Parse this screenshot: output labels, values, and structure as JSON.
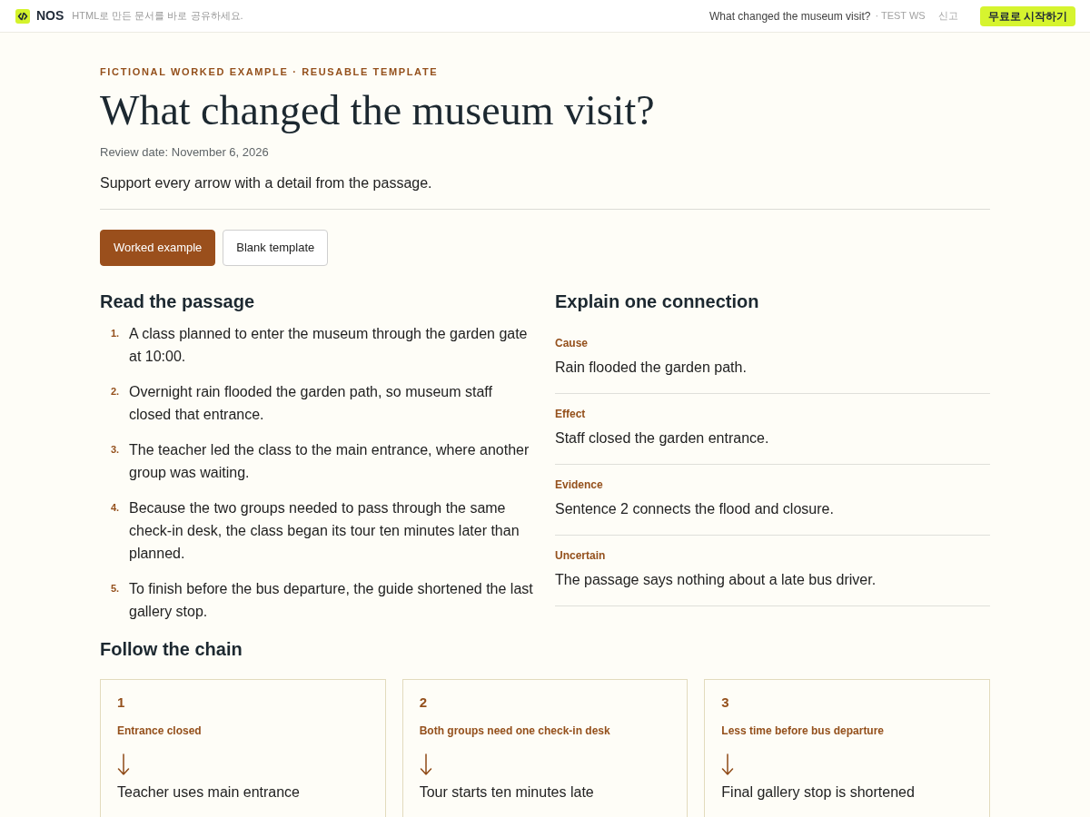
{
  "topbar": {
    "brand": "NOS",
    "tagline": "HTML로 만든 문서를 바로 공유하세요.",
    "doc_title": "What changed the museum visit?",
    "workspace": "· TEST WS",
    "report_link": "신고",
    "cta_button": "무료로 시작하기"
  },
  "header": {
    "eyebrow": "FICTIONAL WORKED EXAMPLE · REUSABLE TEMPLATE",
    "title": "What changed the museum visit?",
    "review_date": "Review date: November 6, 2026",
    "instruction": "Support every arrow with a detail from the passage."
  },
  "tabs": [
    {
      "label": "Worked example",
      "selected": true
    },
    {
      "label": "Blank template",
      "selected": false
    }
  ],
  "passage": {
    "heading": "Read the passage",
    "items": [
      {
        "number": "1.",
        "text": "A class planned to enter the museum through the garden gate at 10:00."
      },
      {
        "number": "2.",
        "text": "Overnight rain flooded the garden path, so museum staff closed that entrance."
      },
      {
        "number": "3.",
        "text": "The teacher led the class to the main entrance, where another group was waiting."
      },
      {
        "number": "4.",
        "text": "Because the two groups needed to pass through the same check-in desk, the class began its tour ten minutes later than planned."
      },
      {
        "number": "5.",
        "text": "To finish before the bus departure, the guide shortened the last gallery stop."
      }
    ]
  },
  "connection": {
    "heading": "Explain one connection",
    "fields": [
      {
        "label": "Cause",
        "value": "Rain flooded the garden path."
      },
      {
        "label": "Effect",
        "value": "Staff closed the garden entrance."
      },
      {
        "label": "Evidence",
        "value": "Sentence 2 connects the flood and closure."
      },
      {
        "label": "Uncertain",
        "value": "The passage says nothing about a late bus driver."
      }
    ]
  },
  "chain": {
    "heading": "Follow the chain",
    "steps": [
      {
        "number": "1",
        "from": "Entrance closed",
        "to": "Teacher uses main entrance"
      },
      {
        "number": "2",
        "from": "Both groups need one check-in desk",
        "to": "Tour starts ten minutes late"
      },
      {
        "number": "3",
        "from": "Less time before bus departure",
        "to": "Final gallery stop is shortened"
      }
    ]
  }
}
